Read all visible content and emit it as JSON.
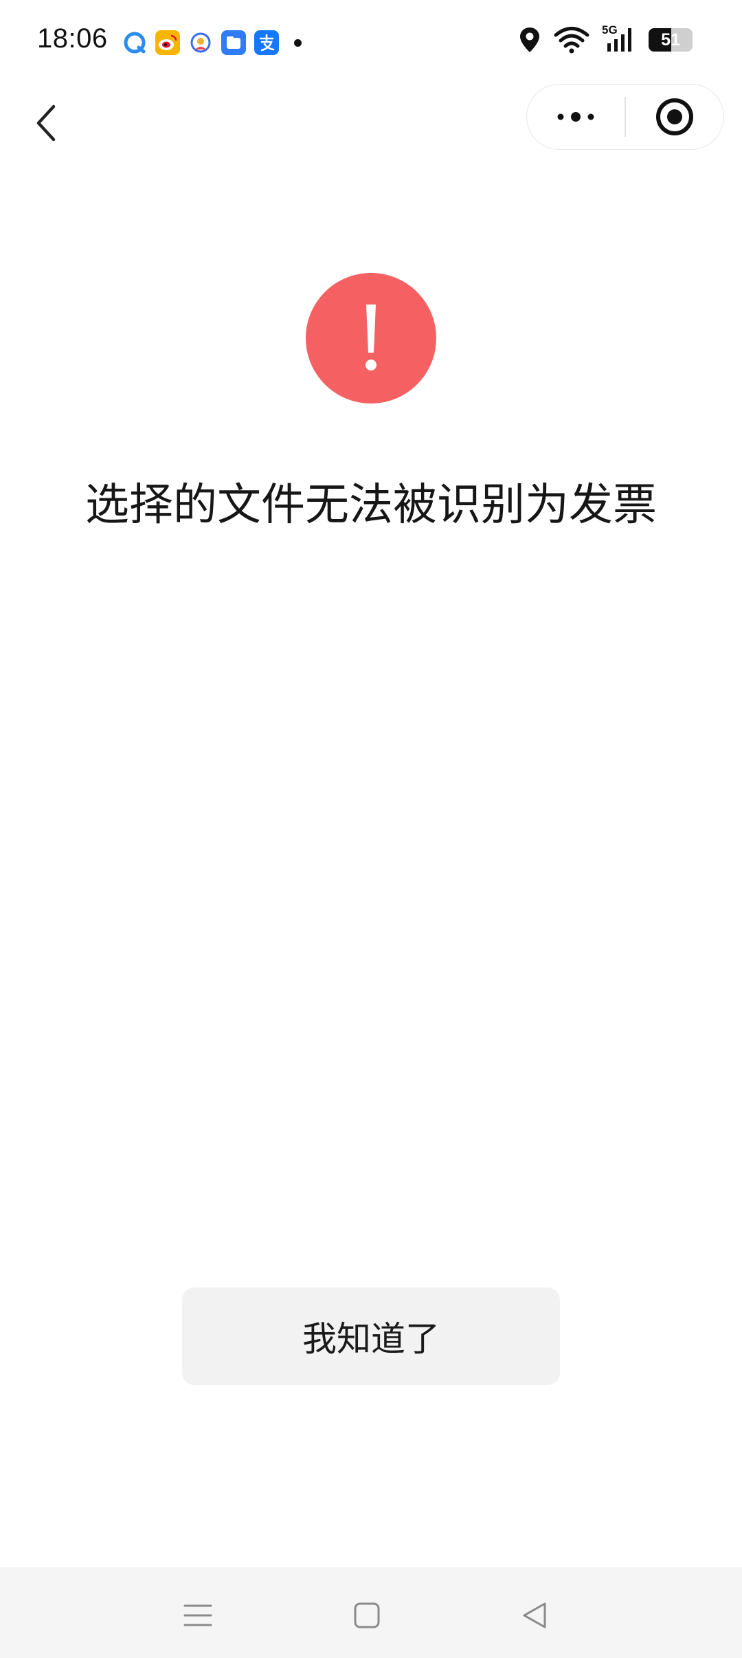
{
  "status_bar": {
    "time": "18:06",
    "notification_icons": [
      "browser-icon",
      "weibo-icon",
      "assistant-icon",
      "files-icon",
      "alipay-icon"
    ],
    "network": "5G",
    "battery_level": "51",
    "battery_fraction": 0.51
  },
  "nav": {
    "back_icon": "chevron-left-icon",
    "capsule": [
      "more-dots-icon",
      "close-target-icon"
    ]
  },
  "content": {
    "alert_icon_glyph": "!",
    "message": "选择的文件无法被识别为发票",
    "confirm_label": "我知道了"
  },
  "colors": {
    "alert_red": "#f56162",
    "button_bg": "#f2f2f2",
    "text": "#161616"
  },
  "system_nav": [
    "menu-icon",
    "home-icon",
    "back-triangle-icon"
  ]
}
